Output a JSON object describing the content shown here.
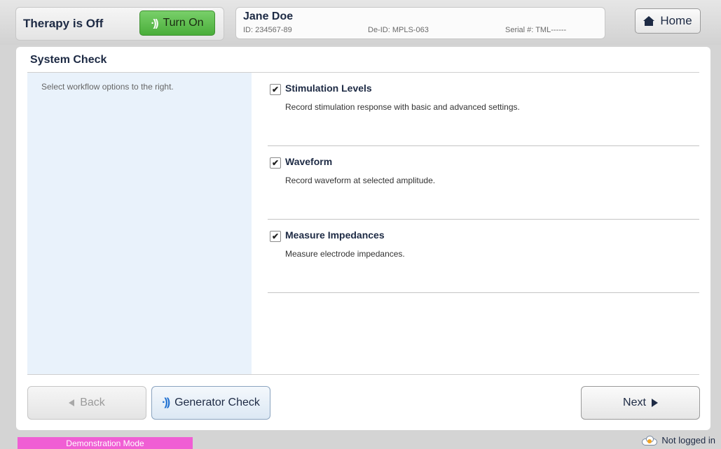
{
  "header": {
    "therapy_status": "Therapy is Off",
    "turn_on_label": "Turn On",
    "home_label": "Home"
  },
  "patient": {
    "name": "Jane Doe",
    "id": "ID: 234567-89",
    "deid": "De-ID: MPLS-063",
    "serial": "Serial #: TML------"
  },
  "page": {
    "title": "System Check",
    "hint": "Select workflow options to the right."
  },
  "options": [
    {
      "label": "Stimulation Levels",
      "description": "Record stimulation response with basic and advanced settings.",
      "checked": true
    },
    {
      "label": "Waveform",
      "description": "Record waveform at selected amplitude.",
      "checked": true
    },
    {
      "label": "Measure Impedances",
      "description": "Measure electrode impedances.",
      "checked": true
    }
  ],
  "footer": {
    "back_label": "Back",
    "generator_check_label": "Generator Check",
    "next_label": "Next"
  },
  "status_bar": {
    "mode": "Demonstration Mode",
    "login": "Not logged in"
  },
  "check_glyph": "✔",
  "colors": {
    "turn_on_green": "#4aae3a",
    "demo_mode_pink": "#f05ed4",
    "wave_icon_blue": "#1e6fd0"
  }
}
